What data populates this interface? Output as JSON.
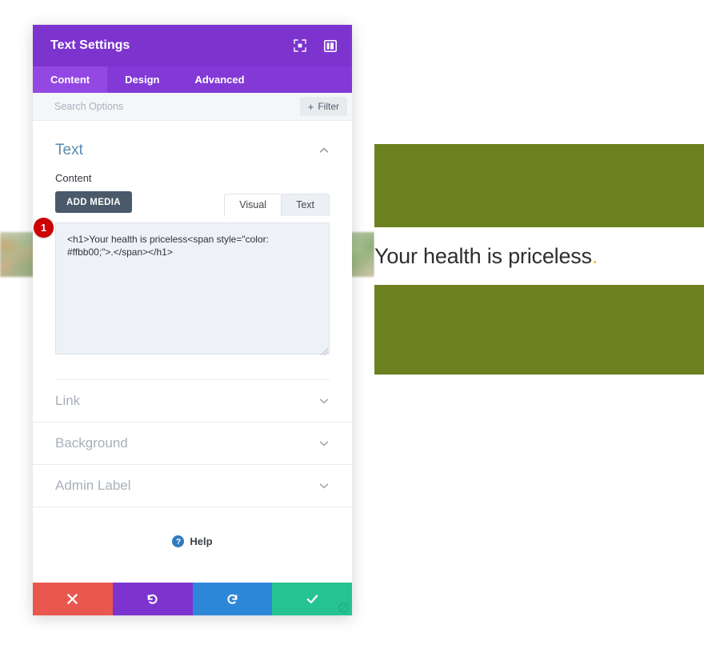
{
  "modal": {
    "title": "Text Settings",
    "header_icons": [
      {
        "name": "focus-icon",
        "label": "Focus"
      },
      {
        "name": "layout-panel-icon",
        "label": "Layout"
      }
    ],
    "tabs": [
      {
        "label": "Content",
        "active": true
      },
      {
        "label": "Design",
        "active": false
      },
      {
        "label": "Advanced",
        "active": false
      }
    ],
    "search": {
      "value": "",
      "placeholder": "Search Options"
    },
    "filter_button": {
      "plus": "+",
      "label": "Filter"
    },
    "sections": [
      {
        "title": "Text",
        "state": "open",
        "field_label": "Content",
        "add_media_label": "ADD MEDIA",
        "editor_tabs": [
          {
            "label": "Visual",
            "active": false
          },
          {
            "label": "Text",
            "active": true
          }
        ],
        "badge": "1",
        "code_value": "<h1>Your health is priceless<span style=\"color: #ffbb00;\">.</span></h1>"
      },
      {
        "title": "Link",
        "state": "closed"
      },
      {
        "title": "Background",
        "state": "closed"
      },
      {
        "title": "Admin Label",
        "state": "closed"
      }
    ],
    "help": {
      "icon_char": "?",
      "label": "Help"
    },
    "footer_buttons": [
      {
        "name": "cancel-button",
        "icon": "close-icon",
        "color": "#e8584f"
      },
      {
        "name": "undo-button",
        "icon": "undo-icon",
        "color": "#7d34cf"
      },
      {
        "name": "redo-button",
        "icon": "redo-icon",
        "color": "#2d87d8"
      },
      {
        "name": "save-button",
        "icon": "check-icon",
        "color": "#25c391"
      }
    ]
  },
  "preview": {
    "headline_text": "Your health is priceless",
    "headline_accent": ".",
    "accent_color": "#ffbb00",
    "block_color": "#6d8020"
  },
  "colors": {
    "header_purple": "#7d34cf",
    "tabbar_purple": "#8239d6",
    "tab_active_purple": "#9448e3",
    "section_title_blue": "#5a8ab0",
    "add_media_slate": "#4a5a6a",
    "badge_red": "#cc0000",
    "code_bg": "#eef2f7"
  }
}
